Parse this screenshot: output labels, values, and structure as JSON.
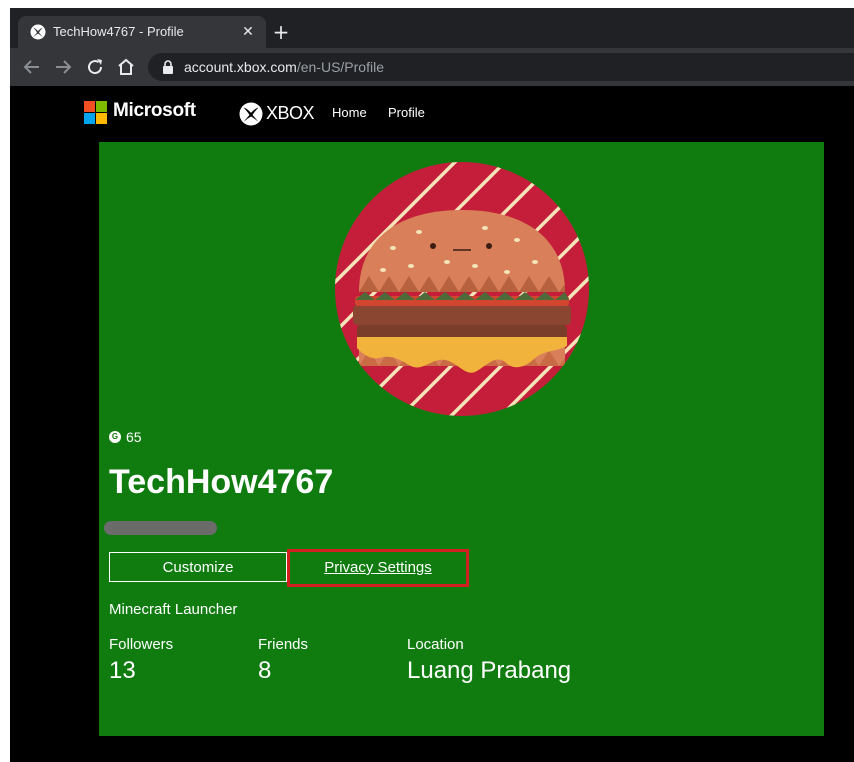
{
  "browser": {
    "tab_title": "TechHow4767 - Profile",
    "tab_close": "✕",
    "new_tab": "+",
    "url_host": "account.xbox.com",
    "url_path": "/en-US/Profile"
  },
  "header": {
    "microsoft_label": "Microsoft",
    "xbox_label": "XBOX",
    "nav": [
      {
        "label": "Home"
      },
      {
        "label": "Profile"
      }
    ]
  },
  "profile": {
    "gamerscore_icon": "G",
    "gamerscore": "65",
    "gamertag": "TechHow4767",
    "buttons": {
      "customize": "Customize",
      "privacy": "Privacy Settings"
    },
    "activity": "Minecraft Launcher",
    "stats": [
      {
        "label": "Followers",
        "value": "13"
      },
      {
        "label": "Friends",
        "value": "8"
      },
      {
        "label": "Location",
        "value": "Luang Prabang"
      }
    ]
  },
  "colors": {
    "card_green": "#107c10",
    "highlight_red": "#d21f1f",
    "avatar_red": "#c41e3a"
  }
}
